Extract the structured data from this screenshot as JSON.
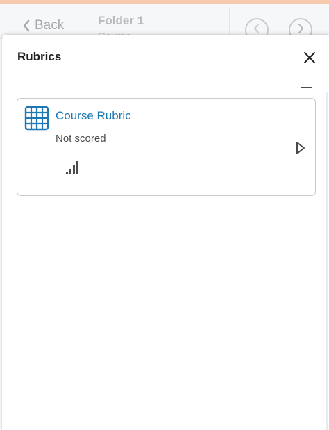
{
  "topbar": {
    "back_label": "Back",
    "folder_title": "Folder 1",
    "folder_subtitle": "Course"
  },
  "panel": {
    "title": "Rubrics"
  },
  "rubric_card": {
    "title": "Course Rubric",
    "status": "Not scored"
  },
  "colors": {
    "accent_link": "#1f78b4",
    "top_accent": "#f7c9ad"
  },
  "icons": [
    "chevron-left-icon",
    "prev-circle-icon",
    "next-circle-icon",
    "close-icon",
    "collapse-icon",
    "grid-table-icon",
    "signal-bars-icon",
    "expand-triangle-icon"
  ]
}
